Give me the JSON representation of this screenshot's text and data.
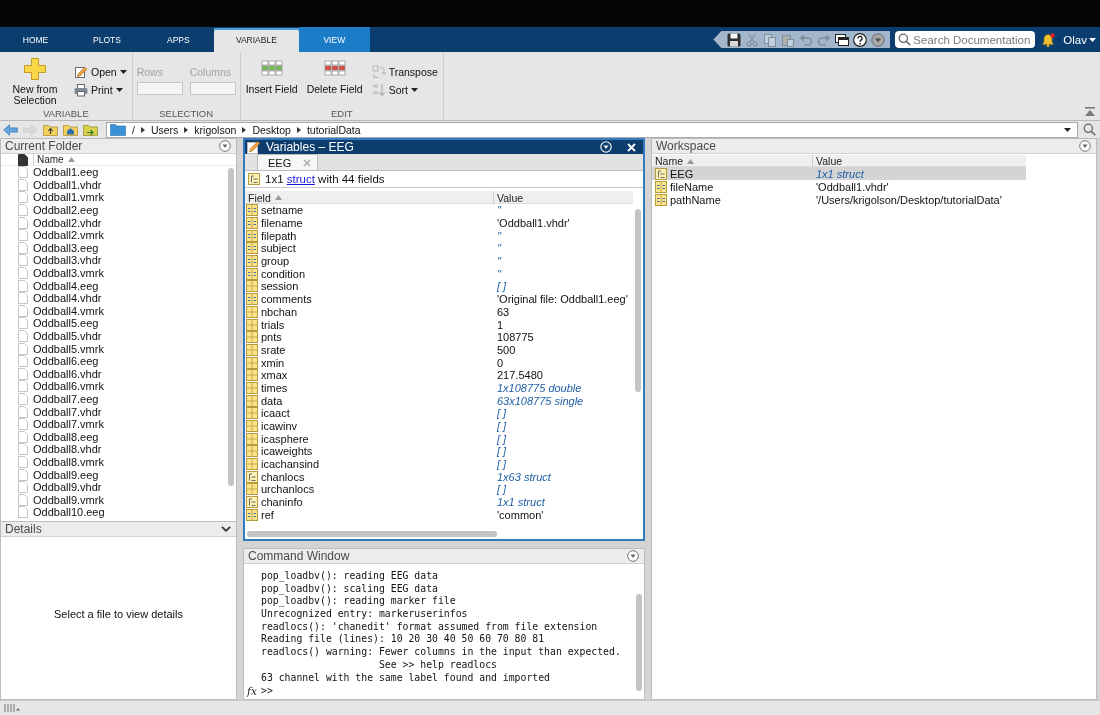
{
  "toolstrip": {
    "tabs": [
      {
        "label": "HOME",
        "selected": false,
        "contextual": false
      },
      {
        "label": "PLOTS",
        "selected": false,
        "contextual": false
      },
      {
        "label": "APPS",
        "selected": false,
        "contextual": false
      },
      {
        "label": "VARIABLE",
        "selected": true,
        "contextual": true
      },
      {
        "label": "VIEW",
        "selected": false,
        "contextual": true
      }
    ],
    "quick_access": [
      {
        "kind": "save",
        "disabled": false
      },
      {
        "kind": "cut",
        "disabled": true
      },
      {
        "kind": "copy",
        "disabled": true
      },
      {
        "kind": "paste",
        "disabled": true
      },
      {
        "kind": "undo",
        "disabled": true
      },
      {
        "kind": "redo",
        "disabled": true
      },
      {
        "kind": "windows",
        "disabled": false
      },
      {
        "kind": "help",
        "disabled": false
      },
      {
        "kind": "more",
        "disabled": false
      }
    ],
    "search": {
      "placeholder": "Search Documentation"
    },
    "user": "Olav",
    "groups": [
      {
        "title": "VARIABLE",
        "columns": [
          [
            {
              "kind": "new",
              "label": "New from Selection",
              "dropdown": false,
              "disabled": false
            }
          ],
          [
            {
              "kind": "open",
              "label": "Open",
              "dropdown": true,
              "disabled": false
            },
            {
              "kind": "print",
              "label": "Print",
              "dropdown": true,
              "disabled": false
            }
          ]
        ]
      },
      {
        "title": "SELECTION",
        "columns": [
          [
            {
              "kind": "field",
              "label": "Rows",
              "dropdown": false,
              "disabled": true
            }
          ],
          [
            {
              "kind": "field",
              "label": "Columns",
              "dropdown": false,
              "disabled": true
            }
          ]
        ]
      },
      {
        "title": "EDIT",
        "columns": [
          [
            {
              "kind": "insert",
              "label": "Insert Field",
              "dropdown": false,
              "disabled": false
            }
          ],
          [
            {
              "kind": "delete",
              "label": "Delete Field",
              "dropdown": false,
              "disabled": false
            }
          ],
          [
            {
              "kind": "transpose",
              "label": "Transpose",
              "dropdown": false,
              "disabled": false
            },
            {
              "kind": "sort",
              "label": "Sort",
              "dropdown": true,
              "disabled": false
            }
          ]
        ]
      }
    ]
  },
  "path_bar": {
    "nav": [
      {
        "kind": "back",
        "disabled": false
      },
      {
        "kind": "forward",
        "disabled": true
      },
      {
        "kind": "up",
        "disabled": false
      },
      {
        "kind": "browse",
        "disabled": false
      },
      {
        "kind": "find",
        "disabled": false
      }
    ],
    "segments": [
      "/",
      "Users",
      "krigolson",
      "Desktop",
      "tutorialData"
    ]
  },
  "current_folder": {
    "title": "Current Folder",
    "columns": [
      {
        "label": "Name",
        "sorted": true
      }
    ],
    "files": [
      "Oddball1.eeg",
      "Oddball1.vhdr",
      "Oddball1.vmrk",
      "Oddball2.eeg",
      "Oddball2.vhdr",
      "Oddball2.vmrk",
      "Oddball3.eeg",
      "Oddball3.vhdr",
      "Oddball3.vmrk",
      "Oddball4.eeg",
      "Oddball4.vhdr",
      "Oddball4.vmrk",
      "Oddball5.eeg",
      "Oddball5.vhdr",
      "Oddball5.vmrk",
      "Oddball6.eeg",
      "Oddball6.vhdr",
      "Oddball6.vmrk",
      "Oddball7.eeg",
      "Oddball7.vhdr",
      "Oddball7.vmrk",
      "Oddball8.eeg",
      "Oddball8.vhdr",
      "Oddball8.vmrk",
      "Oddball9.eeg",
      "Oddball9.vhdr",
      "Oddball9.vmrk",
      "Oddball10.eeg"
    ]
  },
  "details": {
    "title": "Details",
    "expanded": true,
    "message": "Select a file to view details"
  },
  "variables": {
    "title": "Variables – EEG",
    "tabs": [
      {
        "label": "EEG",
        "selected": true
      }
    ],
    "summary": {
      "prefix": "1x1",
      "link": "struct",
      "suffix": "with 44 fields"
    },
    "columns": [
      {
        "label": "Field",
        "sorted": true
      },
      {
        "label": "Value",
        "sorted": false
      }
    ],
    "rows": [
      {
        "field": "setname",
        "value": "''",
        "kind": "char",
        "summary": true
      },
      {
        "field": "filename",
        "value": "'Oddball1.vhdr'",
        "kind": "char",
        "summary": false
      },
      {
        "field": "filepath",
        "value": "''",
        "kind": "char",
        "summary": true
      },
      {
        "field": "subject",
        "value": "''",
        "kind": "char",
        "summary": true
      },
      {
        "field": "group",
        "value": "''",
        "kind": "char",
        "summary": true
      },
      {
        "field": "condition",
        "value": "''",
        "kind": "char",
        "summary": true
      },
      {
        "field": "session",
        "value": "[ ]",
        "kind": "numeric",
        "summary": true
      },
      {
        "field": "comments",
        "value": "'Original file: Oddball1.eeg'",
        "kind": "char",
        "summary": false
      },
      {
        "field": "nbchan",
        "value": "63",
        "kind": "numeric",
        "summary": false
      },
      {
        "field": "trials",
        "value": "1",
        "kind": "numeric",
        "summary": false
      },
      {
        "field": "pnts",
        "value": "108775",
        "kind": "numeric",
        "summary": false
      },
      {
        "field": "srate",
        "value": "500",
        "kind": "numeric",
        "summary": false
      },
      {
        "field": "xmin",
        "value": "0",
        "kind": "numeric",
        "summary": false
      },
      {
        "field": "xmax",
        "value": "217.5480",
        "kind": "numeric",
        "summary": false
      },
      {
        "field": "times",
        "value": "1x108775 double",
        "kind": "numeric",
        "summary": true
      },
      {
        "field": "data",
        "value": "63x108775 single",
        "kind": "numeric",
        "summary": true
      },
      {
        "field": "icaact",
        "value": "[ ]",
        "kind": "numeric",
        "summary": true
      },
      {
        "field": "icawinv",
        "value": "[ ]",
        "kind": "numeric",
        "summary": true
      },
      {
        "field": "icasphere",
        "value": "[ ]",
        "kind": "numeric",
        "summary": true
      },
      {
        "field": "icaweights",
        "value": "[ ]",
        "kind": "numeric",
        "summary": true
      },
      {
        "field": "icachansind",
        "value": "[ ]",
        "kind": "numeric",
        "summary": true
      },
      {
        "field": "chanlocs",
        "value": "1x63 struct",
        "kind": "struct",
        "summary": true
      },
      {
        "field": "urchanlocs",
        "value": "[ ]",
        "kind": "numeric",
        "summary": true
      },
      {
        "field": "chaninfo",
        "value": "1x1 struct",
        "kind": "struct",
        "summary": true
      },
      {
        "field": "ref",
        "value": "'common'",
        "kind": "char",
        "summary": false
      }
    ]
  },
  "command_window": {
    "title": "Command Window",
    "lines": [
      "pop_loadbv(): reading EEG data",
      "pop_loadbv(): scaling EEG data",
      "pop_loadbv(): reading marker file",
      "Unrecognized entry: markeruserinfos",
      "readlocs(): 'chanedit' format assumed from file extension",
      "Reading file (lines): 10 20 30 40 50 60 70 80 81",
      "readlocs() warning: Fewer columns in the input than expected.",
      "                    See >> help readlocs",
      "63 channel with the same label found and imported"
    ],
    "function_browser": "fx",
    "prompt": ">>"
  },
  "workspace": {
    "title": "Workspace",
    "columns": [
      {
        "label": "Name",
        "sorted": true
      },
      {
        "label": "Value",
        "sorted": false
      }
    ],
    "rows": [
      {
        "name": "EEG",
        "value": "1x1 struct",
        "kind": "struct",
        "summary": true,
        "selected": true
      },
      {
        "name": "fileName",
        "value": "'Oddball1.vhdr'",
        "kind": "char",
        "summary": false,
        "selected": false
      },
      {
        "name": "pathName",
        "value": "'/Users/krigolson/Desktop/tutorialData'",
        "kind": "char",
        "summary": false,
        "selected": false
      }
    ]
  }
}
